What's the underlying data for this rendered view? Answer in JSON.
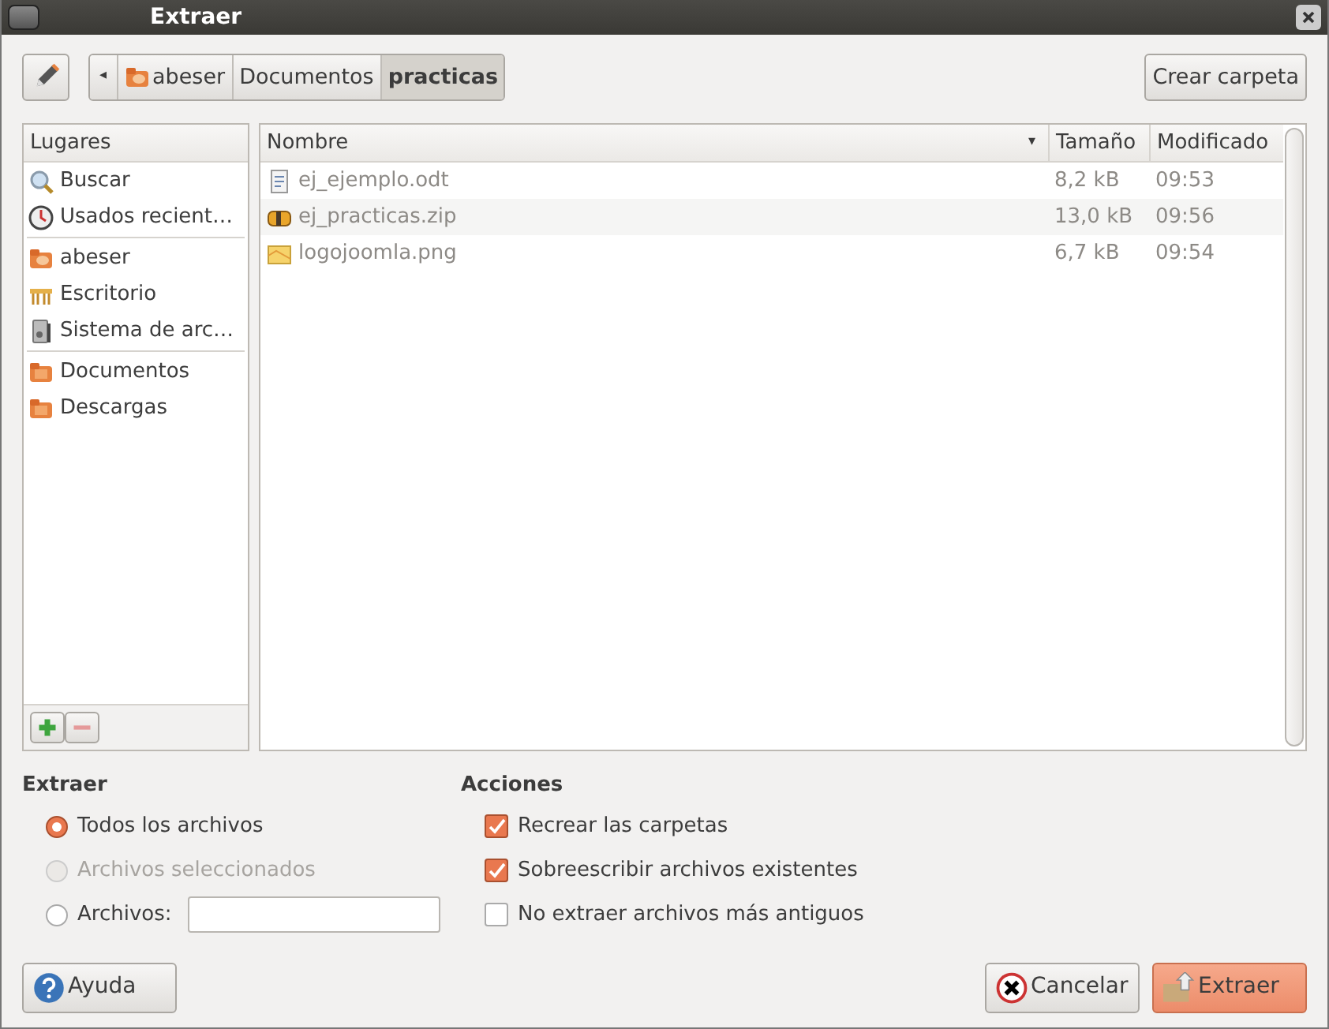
{
  "window": {
    "title": "Extraer"
  },
  "path_bar": {
    "back": "◂",
    "segments": [
      {
        "label": "abeser",
        "kind": "home",
        "selected": false
      },
      {
        "label": "Documentos",
        "selected": false
      },
      {
        "label": "practicas",
        "selected": true
      }
    ]
  },
  "create_folder_button": "Crear carpeta",
  "places": {
    "header": "Lugares",
    "groups": [
      [
        {
          "label": "Buscar",
          "kind": "search"
        },
        {
          "label": "Usados recient…",
          "kind": "recent"
        }
      ],
      [
        {
          "label": "abeser",
          "kind": "home"
        },
        {
          "label": "Escritorio",
          "kind": "desktop"
        },
        {
          "label": "Sistema de arc…",
          "kind": "drive"
        }
      ],
      [
        {
          "label": "Documentos",
          "kind": "folder"
        },
        {
          "label": "Descargas",
          "kind": "folder"
        }
      ]
    ]
  },
  "files": {
    "columns": [
      "Nombre",
      "Tamaño",
      "Modificado"
    ],
    "sort_indicator": "▾",
    "rows": [
      {
        "name": "ej_ejemplo.odt",
        "kind": "document",
        "size": "8,2 kB",
        "modified": "09:53"
      },
      {
        "name": "ej_practicas.zip",
        "kind": "archive",
        "size": "13,0 kB",
        "modified": "09:56"
      },
      {
        "name": "logojoomla.png",
        "kind": "image",
        "size": "6,7 kB",
        "modified": "09:54"
      }
    ]
  },
  "extract": {
    "title": "Extraer",
    "options": [
      {
        "label": "Todos los archivos",
        "selected": true,
        "disabled": false
      },
      {
        "label": "Archivos seleccionados",
        "selected": false,
        "disabled": true
      },
      {
        "label": "Archivos:",
        "selected": false,
        "disabled": false,
        "kind": "field"
      }
    ]
  },
  "actions": {
    "title": "Acciones",
    "options": [
      {
        "label": "Recrear las carpetas",
        "checked": true
      },
      {
        "label": "Sobreescribir archivos existentes",
        "checked": true
      },
      {
        "label": "No extraer archivos más antiguos",
        "checked": false
      }
    ]
  },
  "buttons": [
    {
      "label": "Ayuda",
      "kind": "help"
    },
    {
      "label": "Cancelar",
      "kind": "cancel"
    },
    {
      "label": "Extraer",
      "kind": "extract"
    }
  ]
}
